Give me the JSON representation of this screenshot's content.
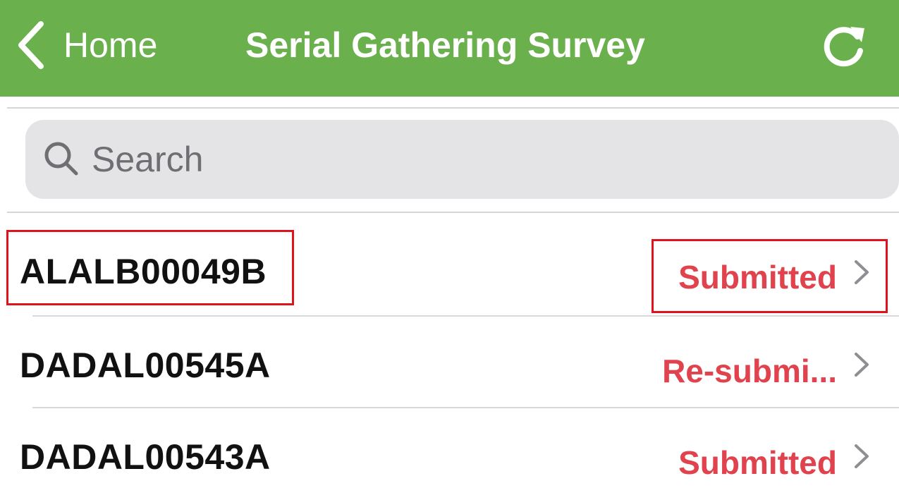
{
  "navbar": {
    "back_label": "Home",
    "title": "Serial Gathering Survey",
    "background_color": "#6ab04c",
    "refresh_icon": "refresh-icon",
    "back_icon": "chevron-left-icon"
  },
  "search": {
    "placeholder": "Search",
    "value": "",
    "icon": "search-icon"
  },
  "list": {
    "status_color": "#e0434d",
    "items": [
      {
        "id": "ALALB00049B",
        "status": "Submitted"
      },
      {
        "id": "DADAL00545A",
        "status": "Re-submi..."
      },
      {
        "id": "DADAL00543A",
        "status": "Submitted"
      }
    ]
  },
  "annotation_color": "#e0121c"
}
